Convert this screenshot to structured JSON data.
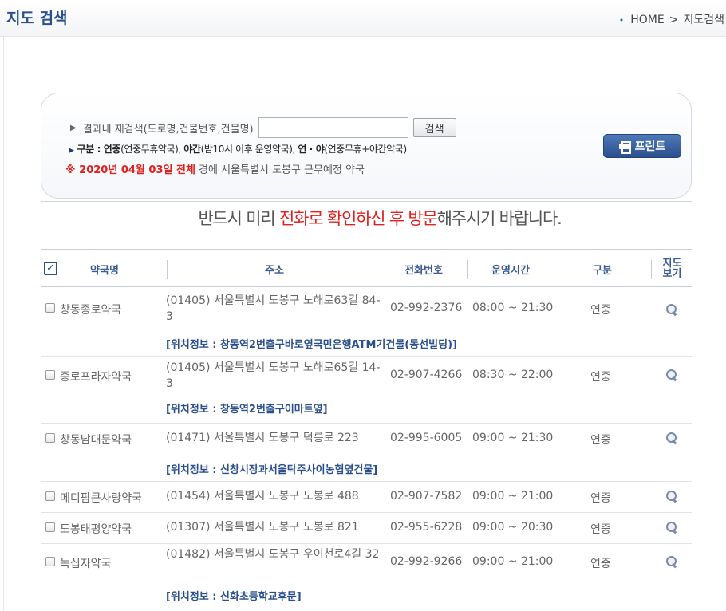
{
  "header": {
    "title": "지도 검색",
    "breadcrumb": [
      "HOME",
      ">",
      "지도검색"
    ]
  },
  "search": {
    "label": "결과내 재검색(도로명,건물번호,건물명)",
    "input_value": "",
    "button_label": "검색",
    "legend": {
      "prefix": "구분 : ",
      "t1": "연중",
      "d1": "(연중무휴약국), ",
      "t2": "야간",
      "d2": "(밤10시 이후 운영약국), ",
      "t3": "연 · 야",
      "d3": "(연중무휴+야간약국)"
    },
    "date_line": {
      "mark": "※ 2020년 04월 03일 전체",
      "rest": " 경에   서울특별시   도봉구    근무예정  약국"
    },
    "print_label": "프린트"
  },
  "notice": {
    "before": "반드시 미리 ",
    "highlight1": "전화로 확인하신 후 방문",
    "after": "해주시기 바랍니다."
  },
  "table": {
    "columns": [
      "약국명",
      "주소",
      "전화번호",
      "운영시간",
      "구분",
      "지도",
      "보기"
    ],
    "rows": [
      {
        "name": "창동종로약국",
        "address": "(01405) 서울특별시 도봉구 노해로63길 84-3",
        "phone": "02-992-2376",
        "hours": "08:00 ~ 21:30",
        "type": "연중",
        "location": "[위치정보 : 창동역2번출구바로옆국민은행ATM기건물(동선빌딩)]"
      },
      {
        "name": "종로프라자약국",
        "address": "(01405) 서울특별시 도봉구 노해로65길 14-3",
        "phone": "02-907-4266",
        "hours": "08:30 ~ 22:00",
        "type": "연중",
        "location": "[위치정보 : 창동역2번출구이마트옆]"
      },
      {
        "name": "창동남대문약국",
        "address": "(01471) 서울특별시 도봉구 덕릉로 223",
        "phone": "02-995-6005",
        "hours": "09:00 ~ 21:30",
        "type": "연중",
        "location": "[위치정보 : 신창시장과서울탁주사이농협옆건물]"
      },
      {
        "name": "메디팜큰사랑약국",
        "address": "(01454) 서울특별시 도봉구 도봉로 488",
        "phone": "02-907-7582",
        "hours": "09:00 ~ 21:00",
        "type": "연중",
        "location": ""
      },
      {
        "name": "도봉태평양약국",
        "address": "(01307) 서울특별시 도봉구 도봉로 821",
        "phone": "02-955-6228",
        "hours": "09:00 ~ 20:30",
        "type": "연중",
        "location": ""
      },
      {
        "name": "녹십자약국",
        "address": "(01482) 서울특별시 도봉구 우이천로4길 32",
        "phone": "02-992-9266",
        "hours": "09:00 ~ 21:00",
        "type": "연중",
        "location": "[위치정보 : 신화초등학교후문]"
      }
    ]
  }
}
